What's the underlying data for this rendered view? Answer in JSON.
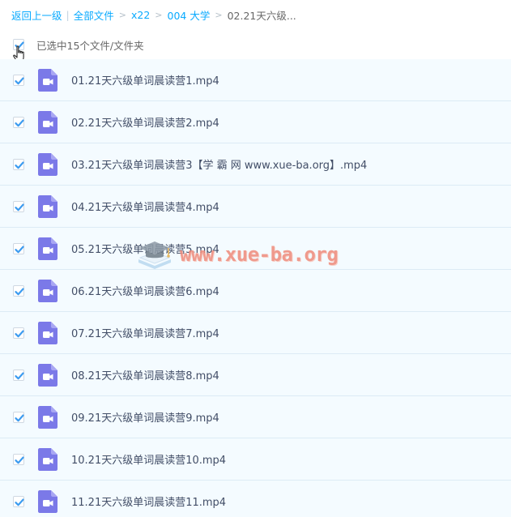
{
  "breadcrumb": {
    "back": "返回上一级",
    "sep_bar": "|",
    "all_files": "全部文件",
    "arrow": ">",
    "level1": "x22",
    "level2": "004 大学",
    "current": "02.21天六级..."
  },
  "selection": {
    "label": "已选中15个文件/文件夹"
  },
  "watermark": {
    "text": "www.xue-ba.org"
  },
  "files": [
    {
      "name": "01.21天六级单词晨读营1.mp4"
    },
    {
      "name": "02.21天六级单词晨读营2.mp4"
    },
    {
      "name": "03.21天六级单词晨读营3【学 霸 网 www.xue-ba.org】.mp4"
    },
    {
      "name": "04.21天六级单词晨读营4.mp4"
    },
    {
      "name": "05.21天六级单词晨读营5.mp4"
    },
    {
      "name": "06.21天六级单词晨读营6.mp4"
    },
    {
      "name": "07.21天六级单词晨读营7.mp4"
    },
    {
      "name": "08.21天六级单词晨读营8.mp4"
    },
    {
      "name": "09.21天六级单词晨读营9.mp4"
    },
    {
      "name": "10.21天六级单词晨读营10.mp4"
    },
    {
      "name": "11.21天六级单词晨读营11.mp4"
    }
  ],
  "colors": {
    "link": "#09aaff",
    "check": "#3b9bf0",
    "video_icon": "#7b79e8",
    "row_bg": "#f4fbff"
  },
  "icons": {
    "checkbox": "check-icon",
    "file": "video-file-icon",
    "cursor": "hand-cursor-icon"
  }
}
